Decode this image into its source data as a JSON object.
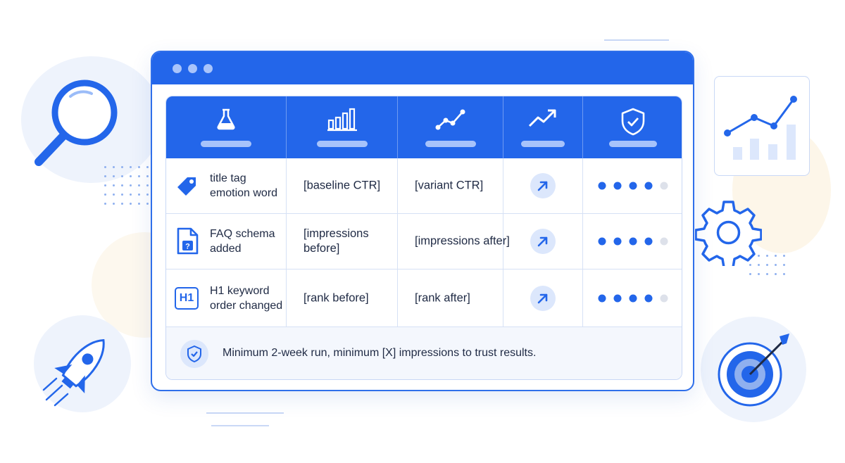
{
  "colors": {
    "accent": "#2366ea",
    "accent_light": "#dce7fc",
    "border": "#c9d8f6",
    "text": "#1f2a44"
  },
  "window": {
    "titlebar_dots": 3
  },
  "table": {
    "header_icons": [
      "flask-icon",
      "bar-chart-icon",
      "line-chart-icon",
      "trend-up-icon",
      "shield-check-icon"
    ],
    "rows": [
      {
        "icon": "tag-icon",
        "test": "title tag emotion word",
        "before": "[baseline CTR]",
        "after": "[variant CTR]",
        "trend": "arrow-up-right-icon",
        "rating": 4,
        "rating_max": 5
      },
      {
        "icon": "faq-document-icon",
        "test": "FAQ schema added",
        "before": "[impressions before]",
        "after": "[impressions after]",
        "trend": "arrow-up-right-icon",
        "rating": 4,
        "rating_max": 5
      },
      {
        "icon": "h1-icon",
        "icon_text": "H1",
        "test": "H1 keyword order changed",
        "before": "[rank before]",
        "after": "[rank after]",
        "trend": "arrow-up-right-icon",
        "rating": 4,
        "rating_max": 5
      }
    ]
  },
  "footer": {
    "icon": "shield-check-icon",
    "note": "Minimum 2-week run, minimum [X] impressions to trust results."
  },
  "decorations": [
    "magnifier-icon",
    "rocket-icon",
    "chart-card-icon",
    "gear-icon",
    "target-icon"
  ]
}
